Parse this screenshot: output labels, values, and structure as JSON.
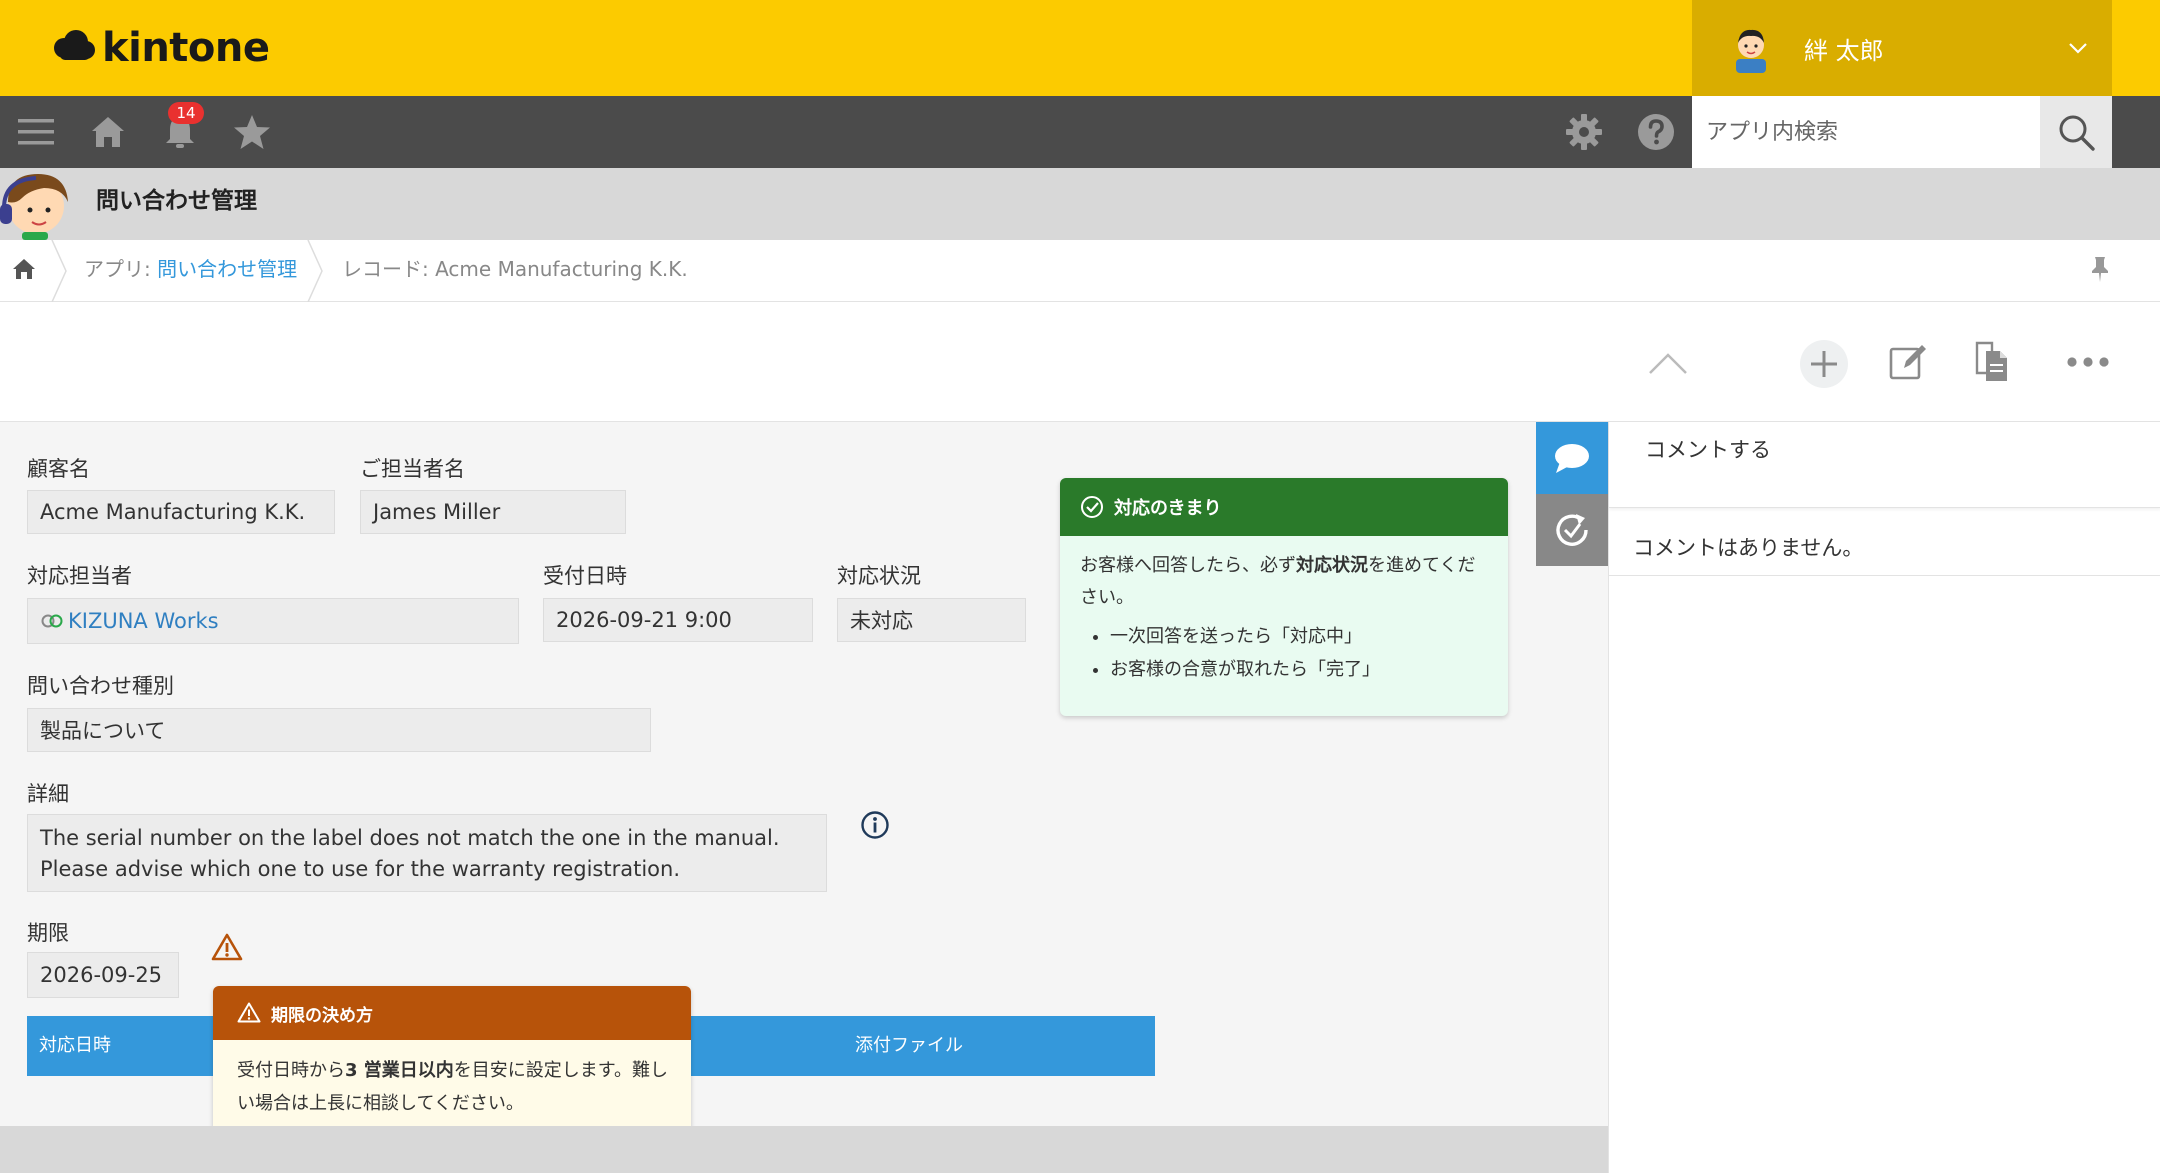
{
  "header": {
    "logo_text": "kintone",
    "user_name": "絆 太郎",
    "brand_color": "#fccb00"
  },
  "toolbar": {
    "notification_count": "14",
    "search_placeholder": "アプリ内検索"
  },
  "app": {
    "title": "問い合わせ管理"
  },
  "breadcrumb": {
    "app_prefix": "アプリ: ",
    "app_name": "問い合わせ管理",
    "record": "レコード: Acme Manufacturing K.K."
  },
  "form": {
    "customer_label": "顧客名",
    "customer_value": "Acme Manufacturing K.K.",
    "contact_label": "ご担当者名",
    "contact_value": "James Miller",
    "assignee_label": "対応担当者",
    "assignee_value": "KIZUNA Works",
    "received_label": "受付日時",
    "received_value": "2026-09-21 9:00",
    "status_label": "対応状況",
    "status_value": "未対応",
    "category_label": "問い合わせ種別",
    "category_value": "製品について",
    "detail_label": "詳細",
    "detail_line1": "The serial number on the label does not match the one in the manual.",
    "detail_line2": "Please advise which one to use for the warranty registration.",
    "deadline_label": "期限",
    "deadline_value": "2026-09-25"
  },
  "rule_note": {
    "title": "対応のきまり",
    "text_pre": "お客様へ回答したら、必ず",
    "text_bold": "対応状況",
    "text_post": "を進めてください。",
    "items": [
      "一次回答を送ったら「対応中」",
      "お客様の合意が取れたら「完了」"
    ]
  },
  "deadline_note": {
    "title": "期限の決め方",
    "text_pre": "受付日時から",
    "text_bold": "3 営業日以内",
    "text_post": "を目安に設定します。難しい場合は上長に相談してください。"
  },
  "table": {
    "col_date": "対応日時",
    "col_attachment": "添付ファイル"
  },
  "comments": {
    "input_placeholder": "コメントする",
    "empty_text": "コメントはありません。"
  }
}
